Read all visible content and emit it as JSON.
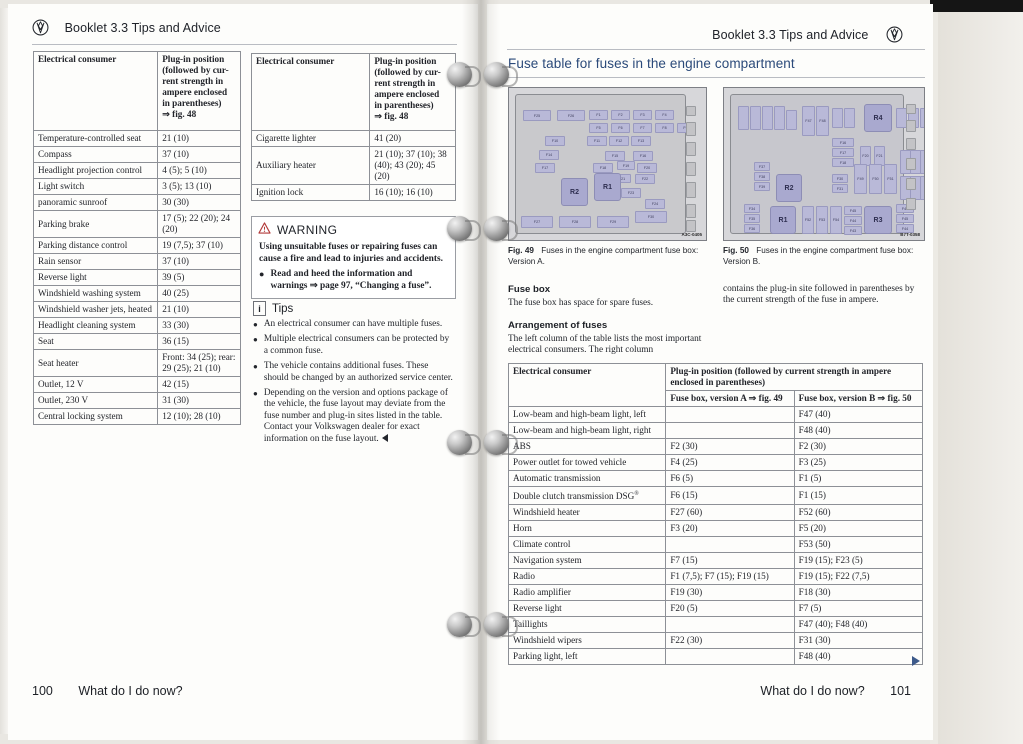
{
  "left_page": {
    "header": {
      "brand_icon": "vw-logo-icon",
      "title": "Booklet 3.3  Tips and Advice"
    },
    "table1": {
      "headers": [
        "Electrical consumer",
        "Plug-in position (followed by current strength in ampere enclosed in parentheses) ⇒ fig. 48"
      ],
      "header_col2_lines": [
        "Plug-in position",
        "(followed by cur-",
        "rent strength in",
        "ampere enclosed",
        "in parentheses)",
        "⇒ fig. 48"
      ],
      "rows": [
        {
          "consumer": "Temperature-controlled seat",
          "position": "21 (10)"
        },
        {
          "consumer": "Compass",
          "position": "37 (10)"
        },
        {
          "consumer": "Headlight projection control",
          "position": "4 (5); 5 (10)"
        },
        {
          "consumer": "Light switch",
          "position": "3 (5); 13 (10)"
        },
        {
          "consumer": "panoramic sunroof",
          "position": "30 (30)"
        },
        {
          "consumer": "Parking brake",
          "position": "17 (5); 22 (20); 24 (20)"
        },
        {
          "consumer": "Parking distance control",
          "position": "19 (7,5); 37 (10)"
        },
        {
          "consumer": "Rain sensor",
          "position": "37 (10)"
        },
        {
          "consumer": "Reverse light",
          "position": "39 (5)"
        },
        {
          "consumer": "Windshield washing system",
          "position": "40 (25)"
        },
        {
          "consumer": "Windshield washer jets, heated",
          "position": "21 (10)"
        },
        {
          "consumer": "Headlight cleaning system",
          "position": "33 (30)"
        },
        {
          "consumer": "Seat",
          "position": "36 (15)"
        },
        {
          "consumer": "Seat heater",
          "position": "Front: 34 (25); rear: 29 (25); 21 (10)"
        },
        {
          "consumer": "Outlet, 12 V",
          "position": "42 (15)"
        },
        {
          "consumer": "Outlet, 230 V",
          "position": "31 (30)"
        },
        {
          "consumer": "Central locking system",
          "position": "12 (10); 28 (10)"
        }
      ]
    },
    "table2": {
      "headers": [
        "Electrical consumer",
        "Plug-in position (followed by current strength in ampere enclosed in parentheses) ⇒ fig. 48"
      ],
      "header_col2_lines": [
        "Plug-in position",
        "(followed by cur-",
        "rent strength in",
        "ampere enclosed",
        "in parentheses)",
        "⇒ fig. 48"
      ],
      "rows": [
        {
          "consumer": "Cigarette lighter",
          "position": "41 (20)"
        },
        {
          "consumer": "Auxiliary heater",
          "position": "21 (10); 37 (10); 38 (40); 43 (20); 45 (20)"
        },
        {
          "consumer": "Ignition lock",
          "position": "16 (10); 16 (10)"
        }
      ]
    },
    "warning": {
      "icon": "warning-triangle-icon",
      "title": "WARNING",
      "body": "Using unsuitable fuses or repairing fuses can cause a fire and lead to injuries and accidents.",
      "bullets": [
        "Read and heed the information and warnings ⇒ page 97, “Changing a fuse”."
      ]
    },
    "tips": {
      "icon": "info-icon",
      "title": "Tips",
      "bullets": [
        "An electrical consumer can have multiple fuses.",
        "Multiple electrical consumers can be protected by a common fuse.",
        "The vehicle contains additional fuses. These should be changed by an authorized service center.",
        "Depending on the version and options package of the vehicle, the fuse layout may deviate from the fuse number and plug-in sites listed in the table. Contact your Volkswagen dealer for exact information on the fuse layout."
      ]
    },
    "footer": {
      "page_number": "100",
      "chapter": "What do I do now?"
    }
  },
  "right_page": {
    "header": {
      "title": "Booklet 3.3  Tips and Advice",
      "brand_icon": "vw-logo-icon"
    },
    "section_title": "Fuse table for fuses in the engine compartment",
    "figures": [
      {
        "name": "fig-49",
        "label": "Fig. 49",
        "caption": "Fuses in the engine compartment fuse box: Version A.",
        "code": "A3C-0405",
        "relays": [
          "R2",
          "R1"
        ]
      },
      {
        "name": "fig-50",
        "label": "Fig. 50",
        "caption": "Fuses in the engine compartment fuse box: Version B.",
        "code": "B7T-0358",
        "relays": [
          "R1",
          "R2",
          "R3",
          "R4"
        ]
      }
    ],
    "body_left": [
      {
        "heading": "Fuse box",
        "text": "The fuse box has space for spare fuses."
      },
      {
        "heading": "Arrangement of fuses",
        "text": "The left column of the table lists the most important electrical consumers. The right column"
      }
    ],
    "body_right": [
      {
        "heading": "",
        "text": "contains the plug-in site followed in parentheses by the current strength of the fuse in ampere."
      }
    ],
    "table": {
      "col1_header": "Electrical consumer",
      "col2_header": "Plug-in position (followed by current strength in ampere enclosed in parentheses)",
      "sub_headers": [
        "Fuse box, version A ⇒ fig. 49",
        "Fuse box, version B ⇒ fig. 50"
      ],
      "rows": [
        {
          "consumer": "Low-beam and high-beam light, left",
          "version_a": "",
          "version_b": "F47 (40)"
        },
        {
          "consumer": "Low-beam and high-beam light, right",
          "version_a": "",
          "version_b": "F48 (40)"
        },
        {
          "consumer": "ABS",
          "version_a": "F2 (30)",
          "version_b": "F2 (30)"
        },
        {
          "consumer": "Power outlet for towed vehicle",
          "version_a": "F4 (25)",
          "version_b": "F3 (25)"
        },
        {
          "consumer": "Automatic transmission",
          "version_a": "F6 (5)",
          "version_b": "F1 (5)"
        },
        {
          "consumer": "Double clutch transmission DSG®",
          "version_a": "F6 (15)",
          "version_b": "F1 (15)"
        },
        {
          "consumer": "Windshield heater",
          "version_a": "F27 (60)",
          "version_b": "F52 (60)"
        },
        {
          "consumer": "Horn",
          "version_a": "F3 (20)",
          "version_b": "F5 (20)"
        },
        {
          "consumer": "Climate control",
          "version_a": "",
          "version_b": "F53 (50)"
        },
        {
          "consumer": "Navigation system",
          "version_a": "F7 (15)",
          "version_b": "F19 (15); F23 (5)"
        },
        {
          "consumer": "Radio",
          "version_a": "F1 (7,5); F7 (15); F19 (15)",
          "version_b": "F19 (15); F22 (7,5)"
        },
        {
          "consumer": "Radio amplifier",
          "version_a": "F19 (30)",
          "version_b": "F18 (30)"
        },
        {
          "consumer": "Reverse light",
          "version_a": "F20 (5)",
          "version_b": "F7 (5)"
        },
        {
          "consumer": "Taillights",
          "version_a": "",
          "version_b": "F47 (40); F48 (40)"
        },
        {
          "consumer": "Windshield wipers",
          "version_a": "F22 (30)",
          "version_b": "F31 (30)"
        },
        {
          "consumer": "Parking light, left",
          "version_a": "",
          "version_b": "F48 (40)"
        }
      ]
    },
    "continue_marker": "blue-right-triangle-icon",
    "footer": {
      "chapter": "What do I do now?",
      "page_number": "101"
    }
  },
  "colors": {
    "accent_blue": "#2b4a7a",
    "page_white": "#fdfdfb",
    "table_border": "#8d9096",
    "fuse_purple": "#b9b9d8",
    "warning_red": "#b23a3a"
  }
}
